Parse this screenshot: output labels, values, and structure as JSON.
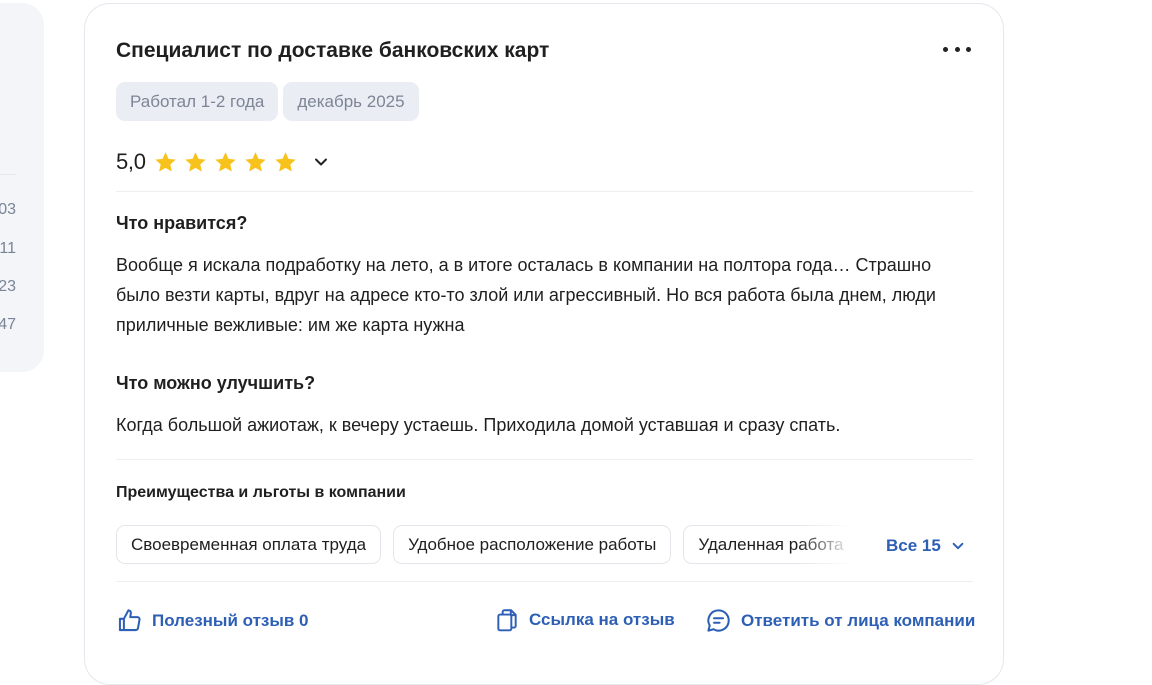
{
  "sidebar": {
    "numbers": [
      "03",
      "11",
      "23",
      "47"
    ]
  },
  "review": {
    "title": "Специалист по доставке банковских карт",
    "tags": [
      "Работал 1-2 года",
      "декабрь 2025"
    ],
    "rating": "5,0",
    "stars": 5,
    "sections": [
      {
        "title": "Что нравится?",
        "text": "Вообще я искала подработку на лето, а в итоге осталась в компании на полтора года… Страшно было везти карты, вдруг на адресе кто-то злой или агрессивный. Но вся работа была днем, люди приличные вежливые: им же карта нужна"
      },
      {
        "title": "Что можно улучшить?",
        "text": "Когда большой ажиотаж, к вечеру устаешь. Приходила домой уставшая и сразу спать."
      }
    ],
    "benefits_title": "Преимущества и льготы в компании",
    "benefits": [
      "Своевременная оплата труда",
      "Удобное расположение работы",
      "Удаленная работа"
    ],
    "benefits_all": "Все 15",
    "actions": {
      "useful": "Полезный отзыв 0",
      "link": "Ссылка на отзыв",
      "reply": "Ответить от лица компании"
    }
  },
  "colors": {
    "accent": "#2d5fb5",
    "star": "#f7c21c",
    "tag_bg": "#eaedf3",
    "text": "#1f1f1f"
  },
  "icons": [
    "more-icon",
    "star-icon",
    "chevron-down-icon",
    "thumbs-up-icon",
    "copy-link-icon",
    "reply-chat-icon"
  ]
}
